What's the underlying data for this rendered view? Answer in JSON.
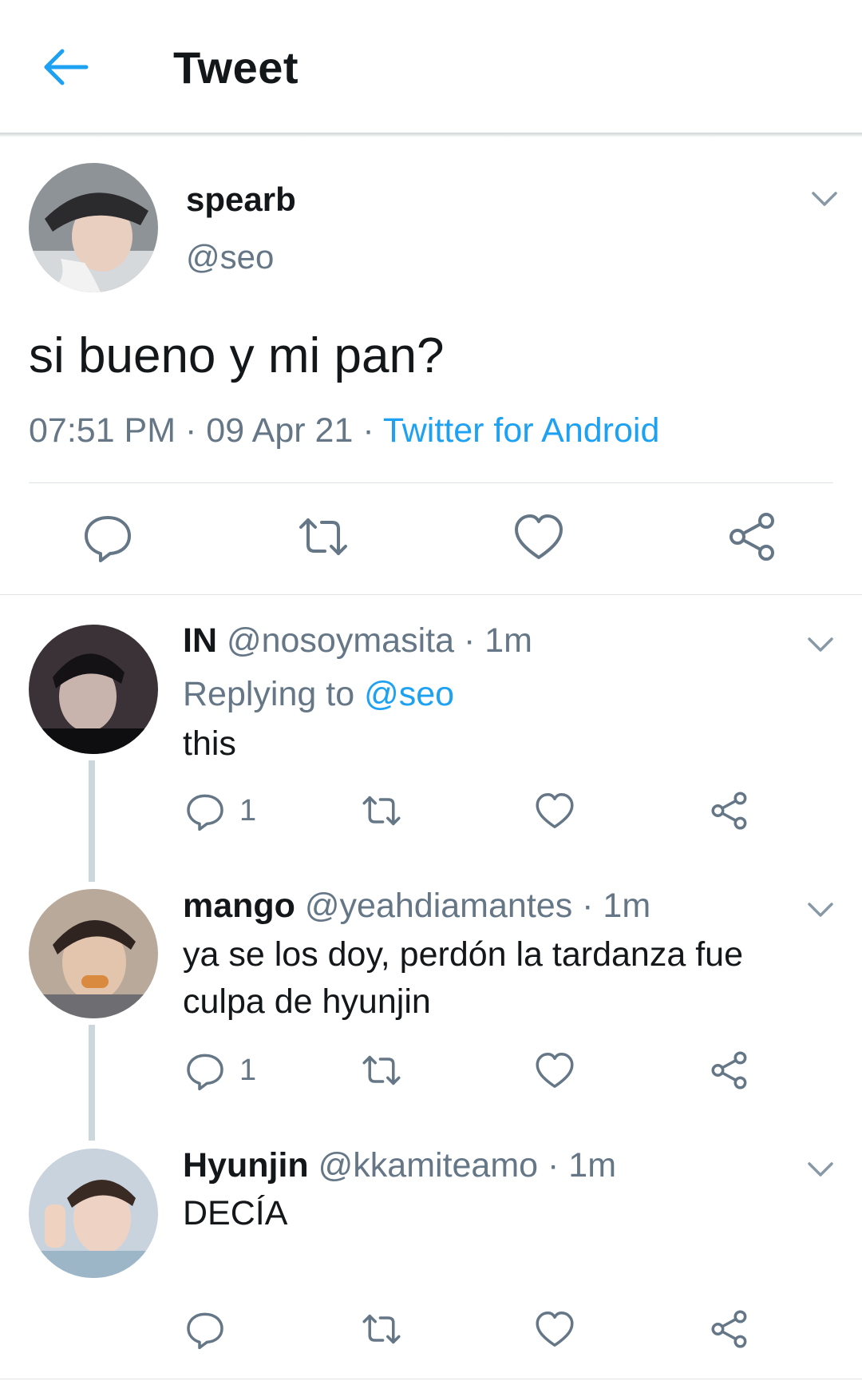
{
  "header": {
    "title": "Tweet"
  },
  "colors": {
    "accent": "#1da1f2",
    "secondary_text": "#657786",
    "icon_gray": "#657786"
  },
  "tweet": {
    "name": "spearb",
    "handle": "@seo",
    "text": "si bueno y mi pan?",
    "time": "07:51 PM",
    "date": "09 Apr 21",
    "sep": " · ",
    "source": "Twitter for Android"
  },
  "replies": [
    {
      "name": "IN",
      "handle": "@nosoymasita",
      "time": "1m",
      "sep": " · ",
      "replying_label": "Replying to",
      "replying_handle": "@seo",
      "text": "this",
      "reply_count": "1"
    },
    {
      "name": "mango",
      "handle": "@yeahdiamantes",
      "time": "1m",
      "sep": " · ",
      "text": "ya se los doy, perdón la tardanza fue culpa de hyunjin",
      "reply_count": "1"
    },
    {
      "name": "Hyunjin",
      "handle": "@kkamiteamo",
      "time": "1m",
      "sep": " · ",
      "text": "DECÍA"
    }
  ],
  "icons": [
    "back-arrow-icon",
    "chevron-down-icon",
    "reply-icon",
    "retweet-icon",
    "like-icon",
    "share-icon"
  ]
}
